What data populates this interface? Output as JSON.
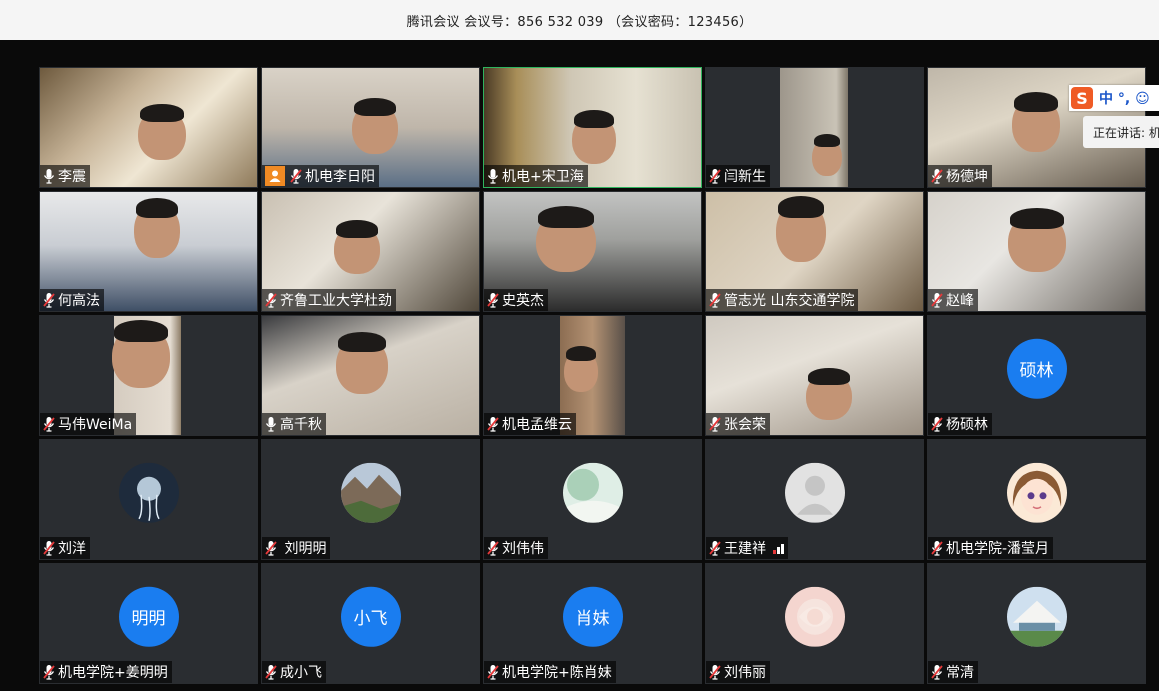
{
  "window": {
    "title": "腾讯会议 会议号：856 532 039 （会议密码：123456）"
  },
  "ime": {
    "logo": "S",
    "mode_label": "中 °, ☺"
  },
  "speaking_indicator": {
    "label": "正在讲话: 机"
  },
  "participants": [
    {
      "name": "李震",
      "mic": "on",
      "view": "video"
    },
    {
      "name": "机电李日阳",
      "mic": "off",
      "view": "video",
      "host_badge": "person-icon"
    },
    {
      "name": "机电+宋卫海",
      "mic": "on",
      "view": "video",
      "active_speaker": true
    },
    {
      "name": "闫新生",
      "mic": "off",
      "view": "video"
    },
    {
      "name": "杨德坤",
      "mic": "off",
      "view": "video"
    },
    {
      "name": "何高法",
      "mic": "off",
      "view": "video"
    },
    {
      "name": "齐鲁工业大学杜劲",
      "mic": "off",
      "view": "video"
    },
    {
      "name": "史英杰",
      "mic": "off",
      "view": "video"
    },
    {
      "name": "管志光 山东交通学院",
      "mic": "off",
      "view": "video"
    },
    {
      "name": "赵峰",
      "mic": "off",
      "view": "video"
    },
    {
      "name": "马伟WeiMa",
      "mic": "off",
      "view": "video"
    },
    {
      "name": "高千秋",
      "mic": "on",
      "view": "video"
    },
    {
      "name": "机电孟维云",
      "mic": "off",
      "view": "video"
    },
    {
      "name": "张会荣",
      "mic": "off",
      "view": "video"
    },
    {
      "name": "杨硕林",
      "mic": "off",
      "view": "avatar-text",
      "avatar_text": "硕林"
    },
    {
      "name": "刘洋",
      "mic": "off",
      "view": "avatar-image",
      "avatar_icon": "jellyfish-avatar"
    },
    {
      "name": " 刘明明",
      "mic": "off",
      "view": "avatar-image",
      "avatar_icon": "landscape-avatar"
    },
    {
      "name": "刘伟伟",
      "mic": "off",
      "view": "avatar-image",
      "avatar_icon": "nature-avatar"
    },
    {
      "name": "王建祥",
      "mic": "off",
      "view": "avatar-image",
      "avatar_icon": "default-user-avatar",
      "signal_icon": "network-signal-icon"
    },
    {
      "name": "机电学院-潘莹月",
      "mic": "off",
      "view": "avatar-image",
      "avatar_icon": "cartoon-girl-avatar"
    },
    {
      "name": "机电学院+姜明明",
      "mic": "off",
      "view": "avatar-text",
      "avatar_text": "明明"
    },
    {
      "name": "成小飞",
      "mic": "off",
      "view": "avatar-text",
      "avatar_text": "小飞"
    },
    {
      "name": "机电学院+陈肖妹",
      "mic": "off",
      "view": "avatar-text",
      "avatar_text": "肖妹"
    },
    {
      "name": "刘伟丽",
      "mic": "off",
      "view": "avatar-image",
      "avatar_icon": "flower-avatar"
    },
    {
      "name": "常清",
      "mic": "off",
      "view": "avatar-image",
      "avatar_icon": "tent-avatar"
    }
  ],
  "colors": {
    "active_border": "#2fb45e",
    "avatar_blue": "#1a7df0",
    "mic_off_red": "#e5393a",
    "tile_bg": "#2a2d31"
  }
}
